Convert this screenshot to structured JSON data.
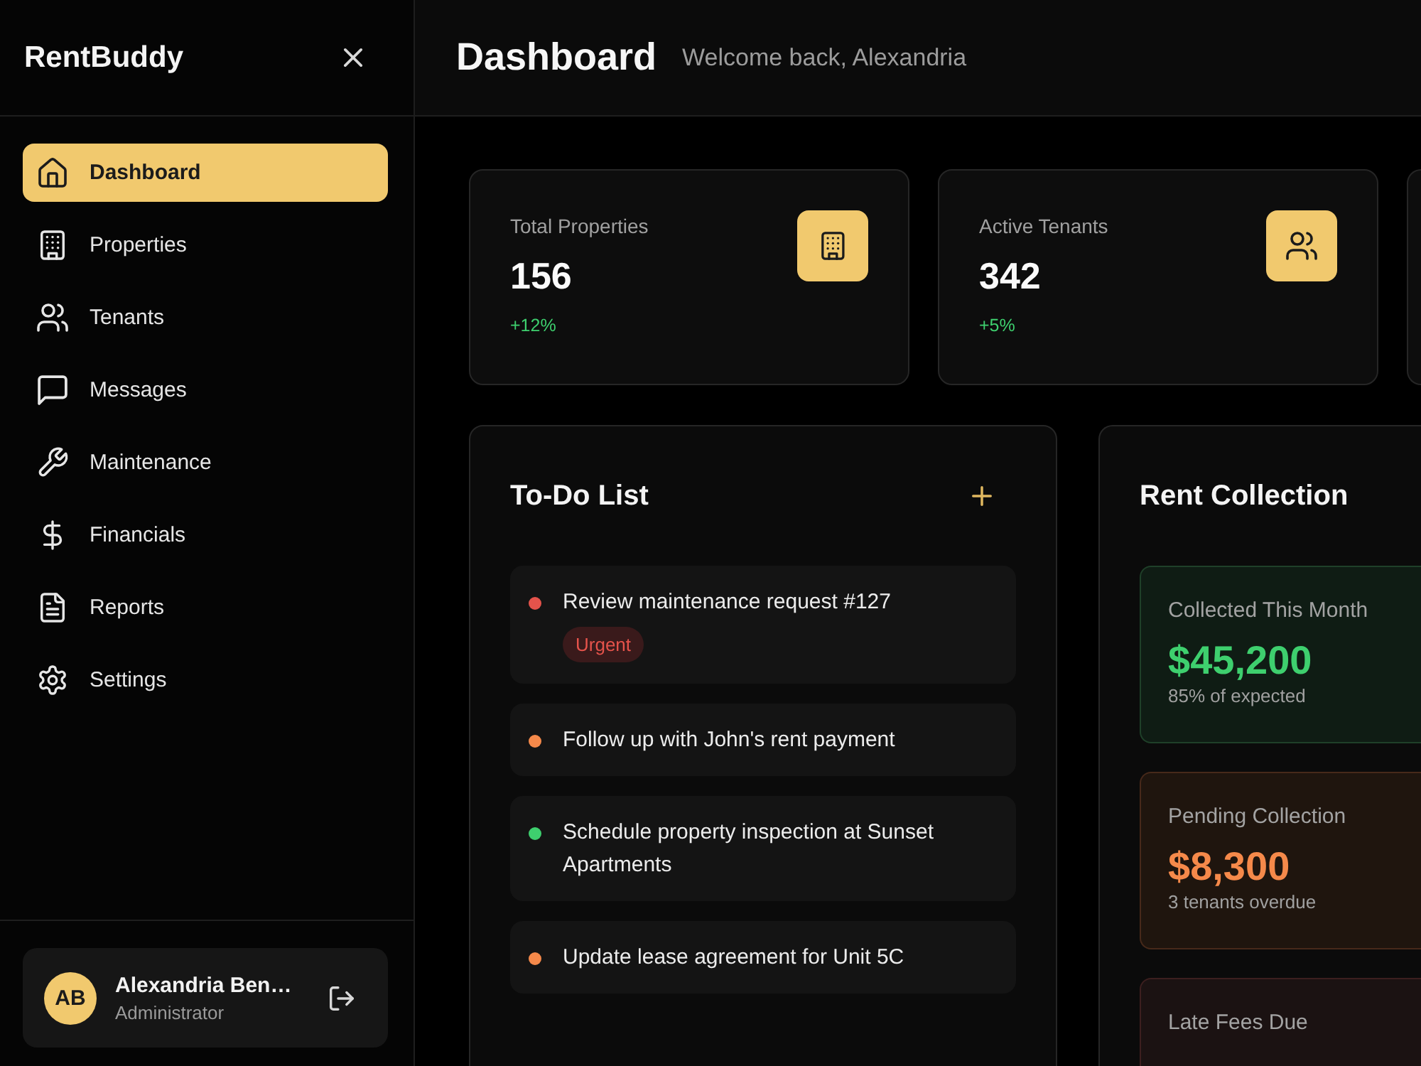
{
  "sidebar": {
    "brand": "RentBuddy",
    "nav_items": [
      {
        "label": "Dashboard",
        "selected": true
      },
      {
        "label": "Properties",
        "selected": false
      },
      {
        "label": "Tenants",
        "selected": false
      },
      {
        "label": "Messages",
        "selected": false
      },
      {
        "label": "Maintenance",
        "selected": false
      },
      {
        "label": "Financials",
        "selected": false
      },
      {
        "label": "Reports",
        "selected": false
      },
      {
        "label": "Settings",
        "selected": false
      }
    ],
    "user": {
      "initials": "AB",
      "name": "Alexandria Ben…",
      "role": "Administrator"
    }
  },
  "header": {
    "title": "Dashboard",
    "subtitle": "Welcome back, Alexandria"
  },
  "stat_cards": [
    {
      "label": "Total Properties",
      "value": "156",
      "change": "+12%"
    },
    {
      "label": "Active Tenants",
      "value": "342",
      "change": "+5%"
    }
  ],
  "todo": {
    "title": "To-Do List",
    "items": [
      {
        "text": "Review maintenance request #127",
        "color": "#e5534b",
        "tag": "Urgent"
      },
      {
        "text": "Follow up with John's rent payment",
        "color": "#f5894a"
      },
      {
        "text": "Schedule property inspection at Sunset Apartments",
        "color": "#3ecf6e"
      },
      {
        "text": "Update lease agreement for Unit 5C",
        "color": "#f5894a"
      }
    ]
  },
  "rent_collection": {
    "title": "Rent Collection",
    "items": [
      {
        "kind": "success",
        "label": "Collected This Month",
        "value": "$45,200",
        "note": "85% of expected"
      },
      {
        "kind": "warning",
        "label": "Pending Collection",
        "value": "$8,300",
        "note": "3 tenants overdue"
      },
      {
        "kind": "danger",
        "label": "Late Fees Due"
      }
    ]
  }
}
